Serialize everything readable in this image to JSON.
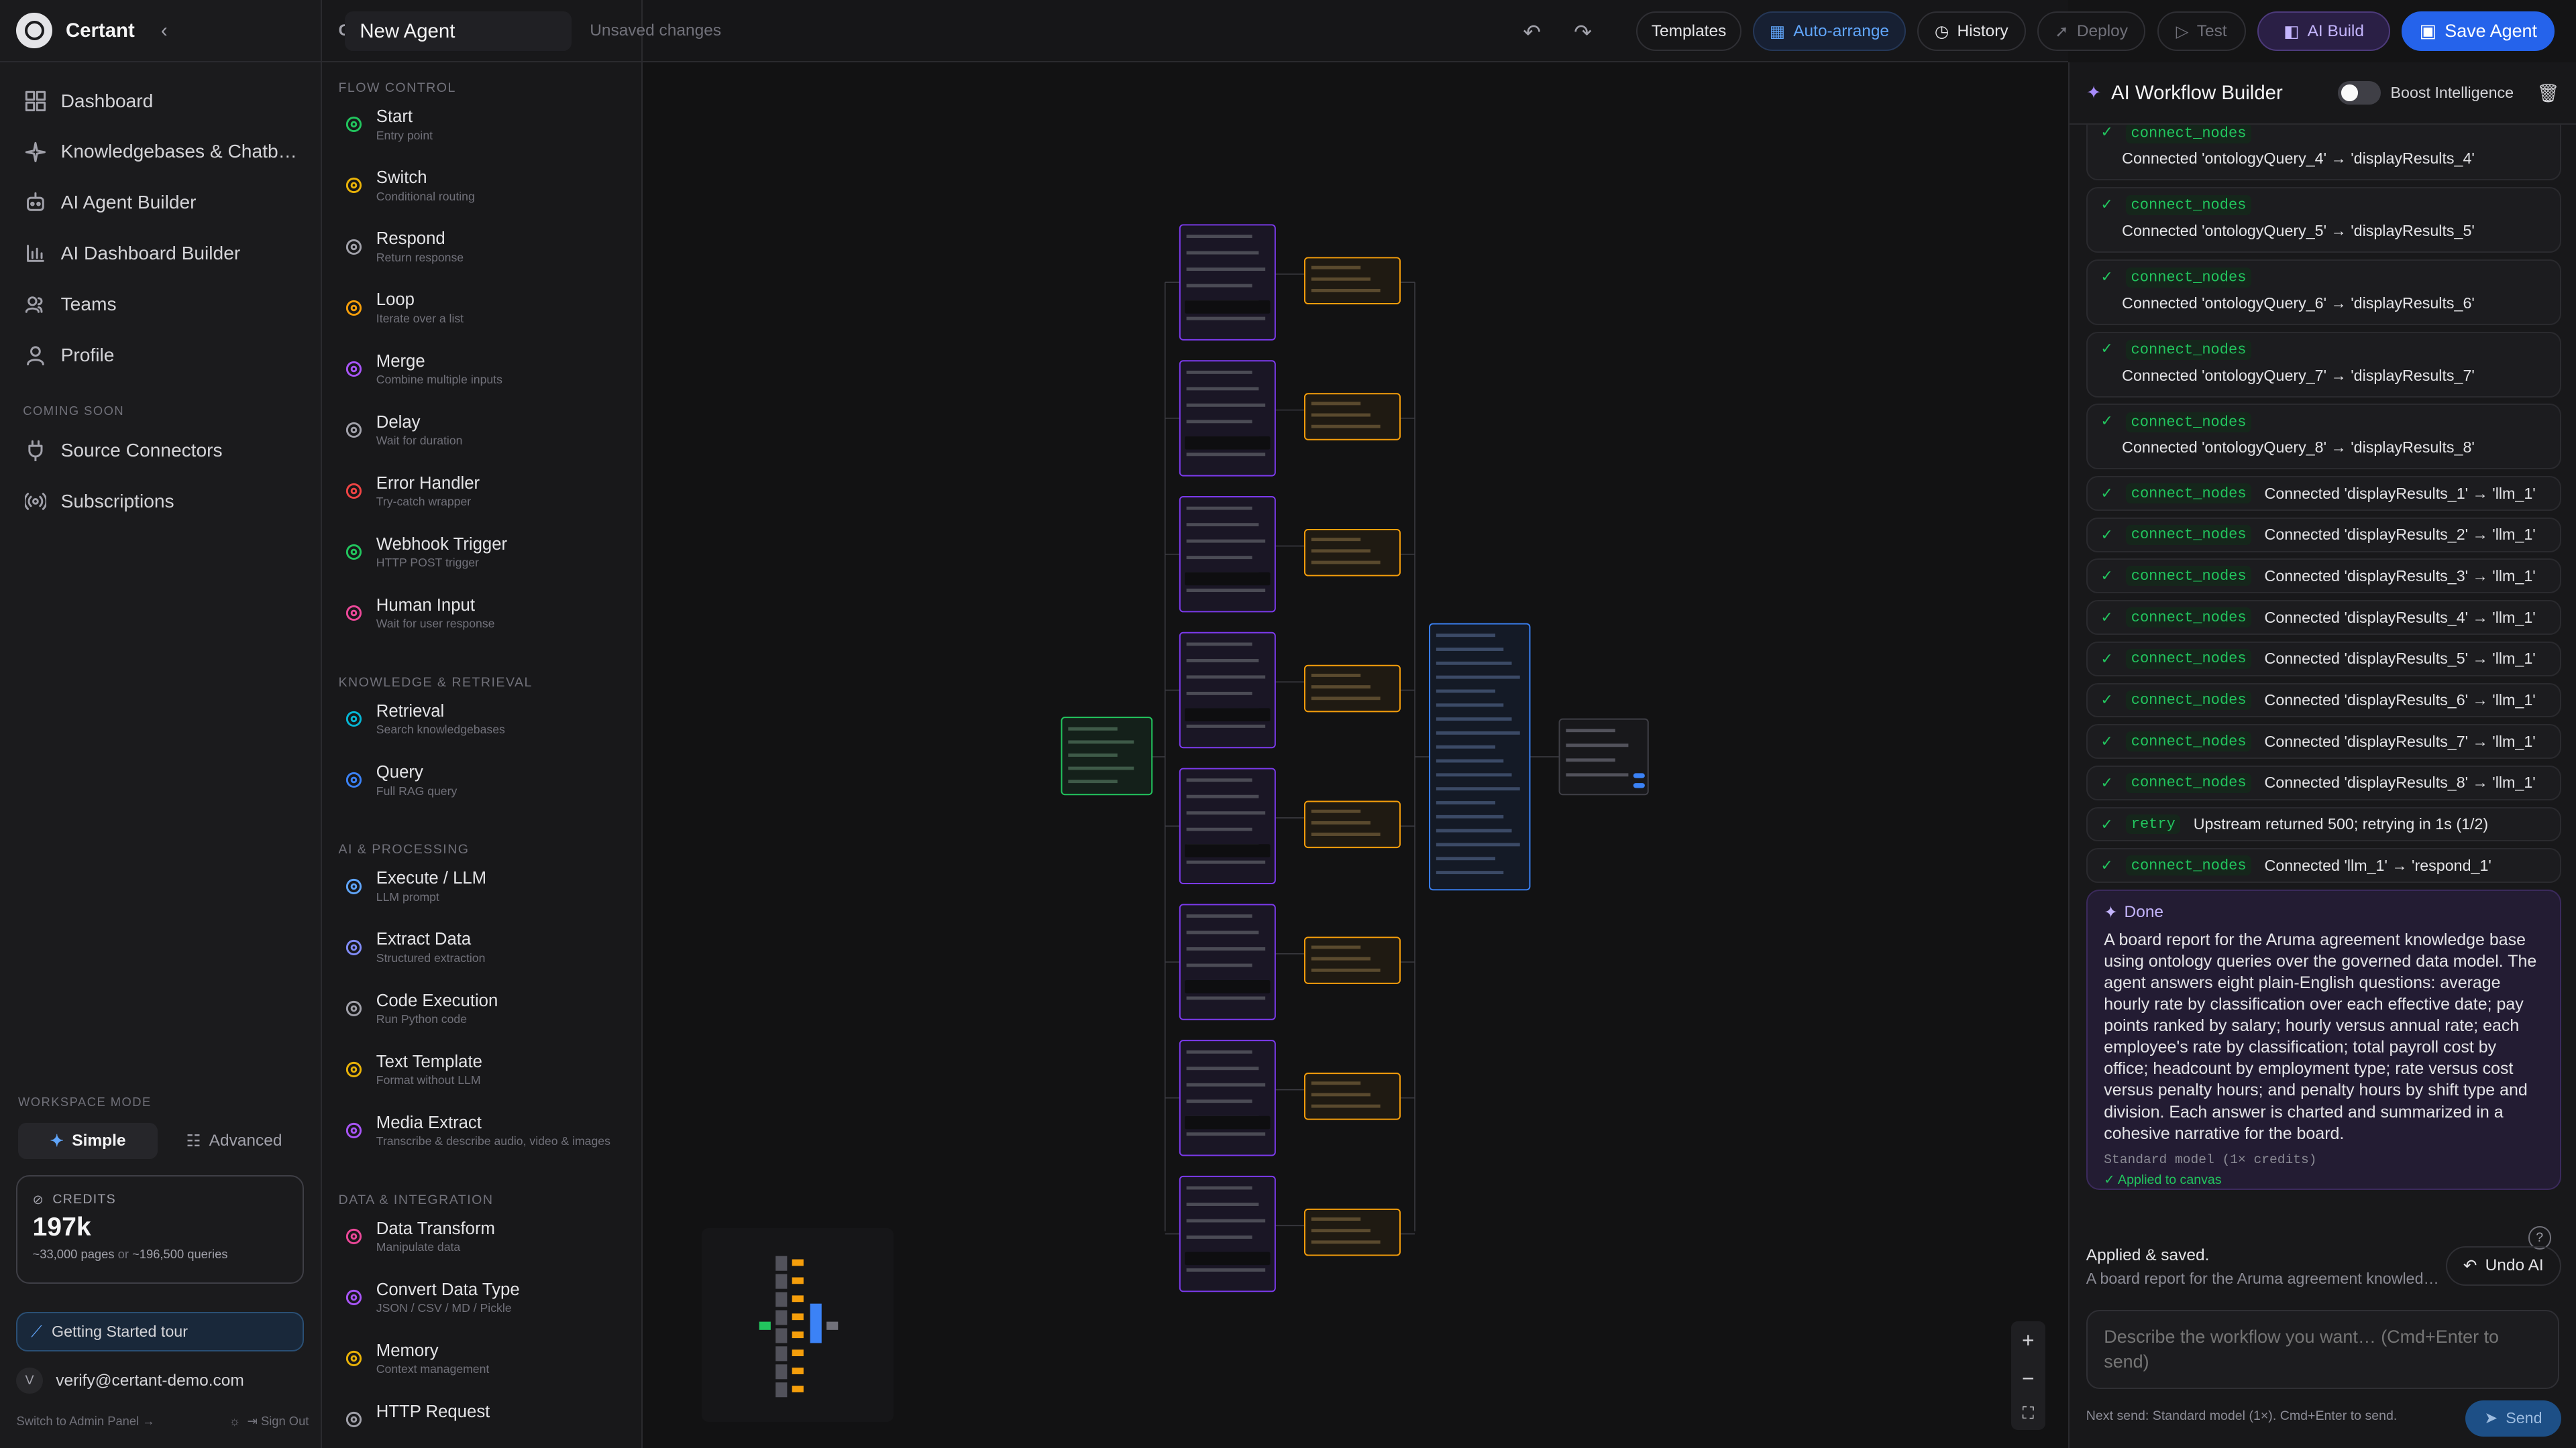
{
  "brand": {
    "name": "Certant"
  },
  "nav": [
    {
      "label": "Dashboard",
      "icon": "grid-icon"
    },
    {
      "label": "Knowledgebases & Chatb…",
      "icon": "sparkle-icon"
    },
    {
      "label": "AI Agent Builder",
      "icon": "bot-icon"
    },
    {
      "label": "AI Dashboard Builder",
      "icon": "bar-chart-icon"
    },
    {
      "label": "Teams",
      "icon": "users-icon"
    },
    {
      "label": "Profile",
      "icon": "user-icon"
    }
  ],
  "coming_soon": {
    "label": "COMING SOON",
    "items": [
      {
        "label": "Source Connectors",
        "icon": "plug-icon"
      },
      {
        "label": "Subscriptions",
        "icon": "broadcast-icon"
      }
    ]
  },
  "workspace": {
    "label": "WORKSPACE MODE",
    "simple": "Simple",
    "advanced": "Advanced"
  },
  "credits": {
    "label": "CREDITS",
    "value": "197k",
    "sub_a": "~33,000 pages",
    "sub_or": "or",
    "sub_b": "~196,500 queries"
  },
  "tour": "Getting Started tour",
  "user": {
    "initial": "V",
    "email": "verify@certant-demo.com"
  },
  "footer": {
    "admin": "Switch to Admin Panel →",
    "signout": "Sign Out"
  },
  "components": {
    "title": "COMPONENTS",
    "categories": [
      {
        "name": "FLOW CONTROL",
        "items": [
          {
            "t": "Start",
            "d": "Entry point",
            "c": "#22c55e"
          },
          {
            "t": "Switch",
            "d": "Conditional routing",
            "c": "#eab308"
          },
          {
            "t": "Respond",
            "d": "Return response",
            "c": "#a1a1aa"
          },
          {
            "t": "Loop",
            "d": "Iterate over a list",
            "c": "#f59e0b"
          },
          {
            "t": "Merge",
            "d": "Combine multiple inputs",
            "c": "#a855f7"
          },
          {
            "t": "Delay",
            "d": "Wait for duration",
            "c": "#a1a1aa"
          },
          {
            "t": "Error Handler",
            "d": "Try-catch wrapper",
            "c": "#ef4444"
          },
          {
            "t": "Webhook Trigger",
            "d": "HTTP POST trigger",
            "c": "#22c55e"
          },
          {
            "t": "Human Input",
            "d": "Wait for user response",
            "c": "#ec4899"
          }
        ]
      },
      {
        "name": "KNOWLEDGE & RETRIEVAL",
        "items": [
          {
            "t": "Retrieval",
            "d": "Search knowledgebases",
            "c": "#06b6d4"
          },
          {
            "t": "Query",
            "d": "Full RAG query",
            "c": "#3b82f6"
          }
        ]
      },
      {
        "name": "AI & PROCESSING",
        "items": [
          {
            "t": "Execute / LLM",
            "d": "LLM prompt",
            "c": "#60a5fa"
          },
          {
            "t": "Extract Data",
            "d": "Structured extraction",
            "c": "#818cf8"
          },
          {
            "t": "Code Execution",
            "d": "Run Python code",
            "c": "#a1a1aa"
          },
          {
            "t": "Text Template",
            "d": "Format without LLM",
            "c": "#eab308"
          },
          {
            "t": "Media Extract",
            "d": "Transcribe & describe audio, video & images",
            "c": "#a855f7"
          }
        ]
      },
      {
        "name": "DATA & INTEGRATION",
        "items": [
          {
            "t": "Data Transform",
            "d": "Manipulate data",
            "c": "#ec4899"
          },
          {
            "t": "Convert Data Type",
            "d": "JSON / CSV / MD / Pickle",
            "c": "#a855f7"
          },
          {
            "t": "Memory",
            "d": "Context management",
            "c": "#eab308"
          },
          {
            "t": "HTTP Request",
            "d": "",
            "c": "#a1a1aa"
          }
        ]
      }
    ]
  },
  "topbar": {
    "agent_name": "New Agent",
    "unsaved": "Unsaved changes",
    "templates": "Templates",
    "auto_arrange": "Auto-arrange",
    "history": "History",
    "deploy": "Deploy",
    "test": "Test",
    "ai_build": "AI Build",
    "save": "Save Agent"
  },
  "panel": {
    "title": "AI Workflow Builder",
    "boost": "Boost Intelligence",
    "logs": [
      {
        "kind": "tall",
        "code": "connect_nodes",
        "text": "Connected 'ontologyQuery_4' → 'displayResults_4'"
      },
      {
        "kind": "tall",
        "code": "connect_nodes",
        "text": "Connected 'ontologyQuery_5' → 'displayResults_5'"
      },
      {
        "kind": "tall",
        "code": "connect_nodes",
        "text": "Connected 'ontologyQuery_6' → 'displayResults_6'"
      },
      {
        "kind": "tall",
        "code": "connect_nodes",
        "text": "Connected 'ontologyQuery_7' → 'displayResults_7'"
      },
      {
        "kind": "tall",
        "code": "connect_nodes",
        "text": "Connected 'ontologyQuery_8' → 'displayResults_8'"
      },
      {
        "kind": "one",
        "code": "connect_nodes",
        "text": "Connected 'displayResults_1' → 'llm_1'"
      },
      {
        "kind": "one",
        "code": "connect_nodes",
        "text": "Connected 'displayResults_2' → 'llm_1'"
      },
      {
        "kind": "one",
        "code": "connect_nodes",
        "text": "Connected 'displayResults_3' → 'llm_1'"
      },
      {
        "kind": "one",
        "code": "connect_nodes",
        "text": "Connected 'displayResults_4' → 'llm_1'"
      },
      {
        "kind": "one",
        "code": "connect_nodes",
        "text": "Connected 'displayResults_5' → 'llm_1'"
      },
      {
        "kind": "one",
        "code": "connect_nodes",
        "text": "Connected 'displayResults_6' → 'llm_1'"
      },
      {
        "kind": "one",
        "code": "connect_nodes",
        "text": "Connected 'displayResults_7' → 'llm_1'"
      },
      {
        "kind": "one",
        "code": "connect_nodes",
        "text": "Connected 'displayResults_8' → 'llm_1'"
      },
      {
        "kind": "one",
        "code": "retry",
        "text": "Upstream returned 500; retrying in 1s (1/2)"
      },
      {
        "kind": "one",
        "code": "connect_nodes",
        "text": "Connected 'llm_1' → 'respond_1'"
      }
    ],
    "done": {
      "title": "Done",
      "text": "A board report for the Aruma agreement knowledge base using ontology queries over the governed data model. The agent answers eight plain-English questions: average hourly rate by classification over each effective date; pay points ranked by salary; hourly versus annual rate; each employee's rate by classification; total payroll cost by office; headcount by employment type; rate versus cost versus penalty hours; and penalty hours by shift type and division. Each answer is charted and summarized in a cohesive narrative for the board.",
      "model": "Standard model (1× credits)",
      "applied": "Applied to canvas"
    },
    "applied": {
      "title": "Applied & saved.",
      "sub": "A board report for the Aruma agreement knowledg…",
      "undo": "Undo AI"
    },
    "input_placeholder": "Describe the workflow you want… (Cmd+Enter to send)",
    "next_send": "Next send: Standard model (1×). Cmd+Enter to send.",
    "send": "Send"
  },
  "colors": {
    "accent": "#3b82f6",
    "query_node": "#7c3aed",
    "display_node": "#f59e0b",
    "start_node": "#22c55e",
    "llm_node": "#3b82f6"
  }
}
